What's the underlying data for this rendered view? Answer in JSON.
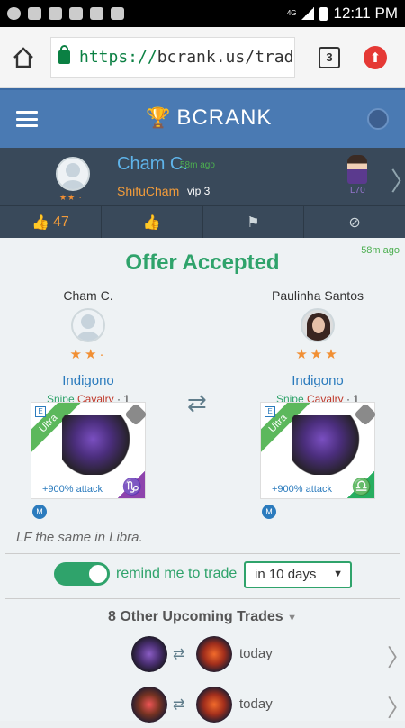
{
  "status_bar": {
    "time": "12:11 PM",
    "network": "4G"
  },
  "browser": {
    "url_scheme": "https://",
    "url_rest": "bcrank.us/trade",
    "tab_count": "3"
  },
  "header": {
    "brand": "BCRANK"
  },
  "poster": {
    "name": "Cham C.",
    "time": "58m ago",
    "nickname": "ShifuCham",
    "vip": "vip 3",
    "level": "L70",
    "likes": "47"
  },
  "trade": {
    "time": "58m ago",
    "title": "Offer Accepted",
    "left": {
      "name": "Cham C.",
      "monster": "Indigono",
      "tag_role": "Snipe",
      "tag_class": "Cavalry",
      "tag_level": "1",
      "rarity": "Ultra",
      "attack": "+900% attack",
      "zodiac": "♑",
      "badge": "M"
    },
    "right": {
      "name": "Paulinha Santos",
      "monster": "Indigono",
      "tag_role": "Snipe",
      "tag_class": "Cavalry",
      "tag_level": "1",
      "rarity": "Ultra",
      "attack": "+900% attack",
      "zodiac": "♎",
      "badge": "M"
    },
    "note": "LF the same in Libra.",
    "remind_label": "remind me to trade",
    "remind_selected": "in 10 days"
  },
  "upcoming": {
    "title": "8 Other Upcoming Trades",
    "rows": [
      {
        "when": "today"
      },
      {
        "when": "today"
      }
    ]
  }
}
